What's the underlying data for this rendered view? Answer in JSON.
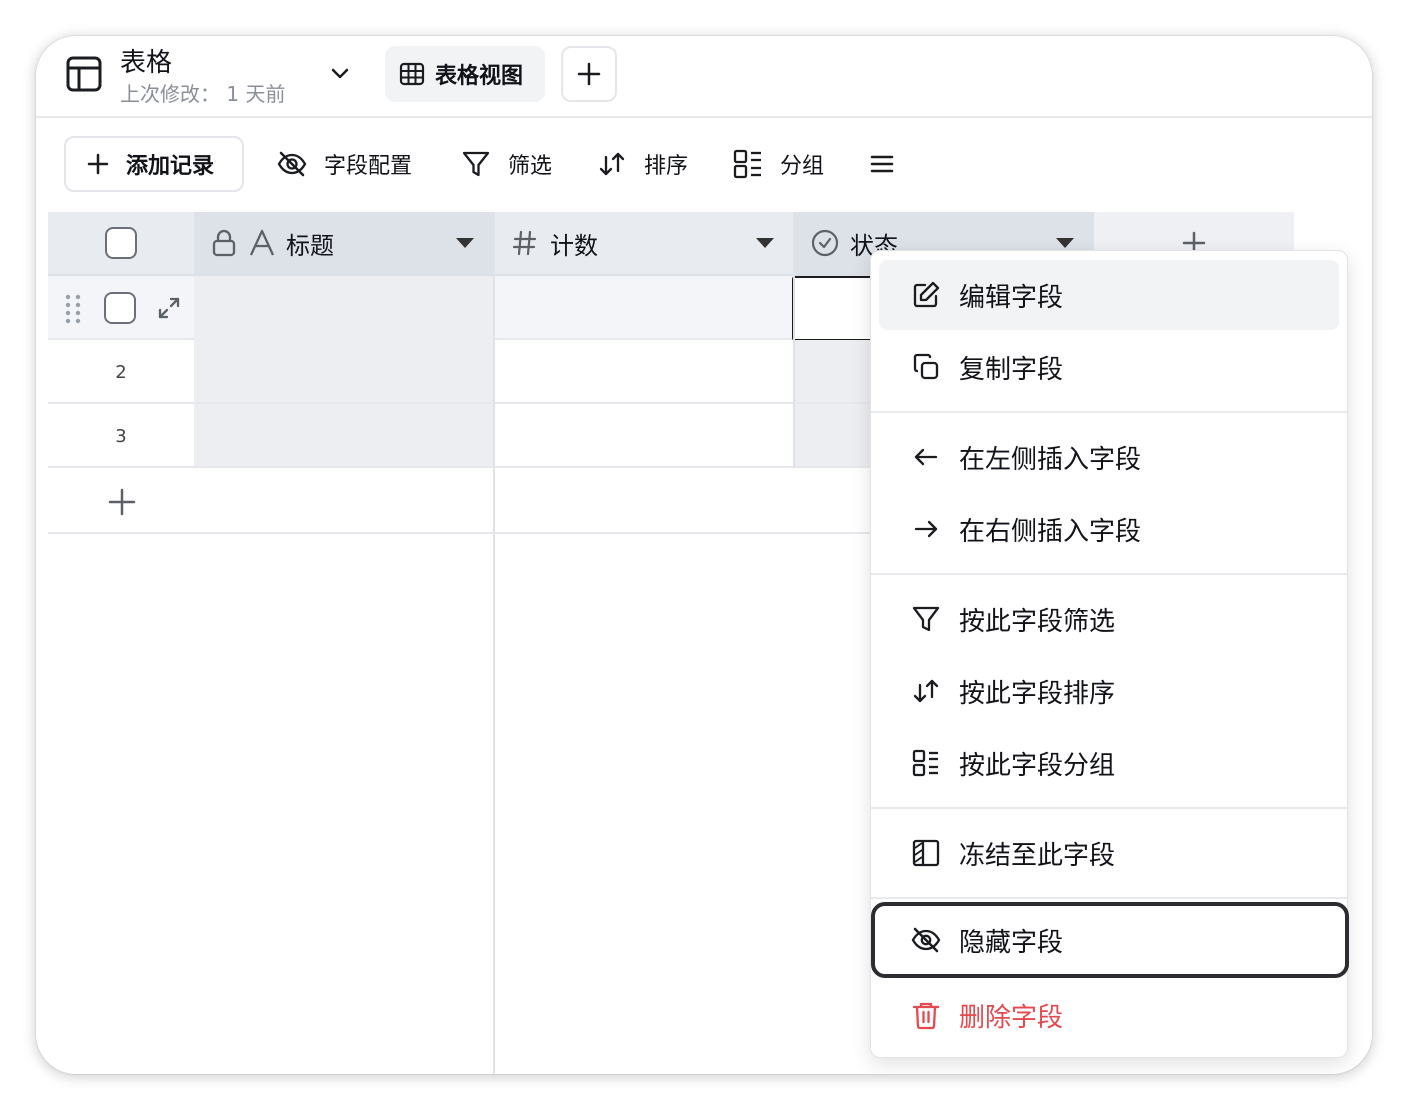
{
  "header": {
    "title": "表格",
    "subtitle": "上次修改：  1 天前",
    "view_tab_label": "表格视图"
  },
  "toolbar": {
    "add_record": "添加记录",
    "field_config": "字段配置",
    "filter": "筛选",
    "sort": "排序",
    "group": "分组"
  },
  "grid": {
    "columns": [
      {
        "label": "标题",
        "type_icon": "text-icon",
        "locked": true
      },
      {
        "label": "计数",
        "type_icon": "hash-icon"
      },
      {
        "label": "状态",
        "type_icon": "check-circle-icon"
      }
    ],
    "row_numbers": [
      "2",
      "3"
    ]
  },
  "context_menu": {
    "items": [
      {
        "label": "编辑字段",
        "icon": "edit-icon"
      },
      {
        "label": "复制字段",
        "icon": "copy-icon"
      },
      {
        "label": "在左侧插入字段",
        "icon": "arrow-left-icon"
      },
      {
        "label": "在右侧插入字段",
        "icon": "arrow-right-icon"
      },
      {
        "label": "按此字段筛选",
        "icon": "filter-icon"
      },
      {
        "label": "按此字段排序",
        "icon": "sort-icon"
      },
      {
        "label": "按此字段分组",
        "icon": "group-icon"
      },
      {
        "label": "冻结至此字段",
        "icon": "freeze-icon"
      },
      {
        "label": "隐藏字段",
        "icon": "eye-off-icon"
      },
      {
        "label": "删除字段",
        "icon": "trash-icon"
      }
    ]
  },
  "colors": {
    "danger": "#e5484d",
    "header_bg": "#e8ebf0",
    "locked_column_bg": "#eceef1"
  }
}
